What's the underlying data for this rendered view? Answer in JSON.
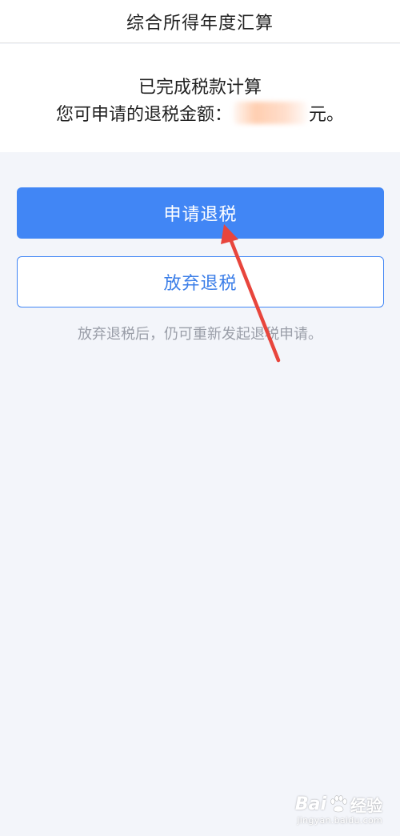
{
  "nav": {
    "title": "综合所得年度汇算"
  },
  "result": {
    "status": "已完成税款计算",
    "refund_label": "您可申请的退税金额：",
    "refund_amount": "",
    "refund_unit": "元。"
  },
  "actions": {
    "apply_label": "申请退税",
    "abandon_label": "放弃退税",
    "hint": "放弃退税后，仍可重新发起退税申请。"
  },
  "watermark": {
    "brand_left": "Bai",
    "brand_right": "经验",
    "site": "jingyan.baidu.com"
  },
  "colors": {
    "primary": "#4186f5",
    "background": "#f3f5fa",
    "annotation_arrow": "#e8453c"
  },
  "icons": {
    "watermark": "paw-icon"
  }
}
